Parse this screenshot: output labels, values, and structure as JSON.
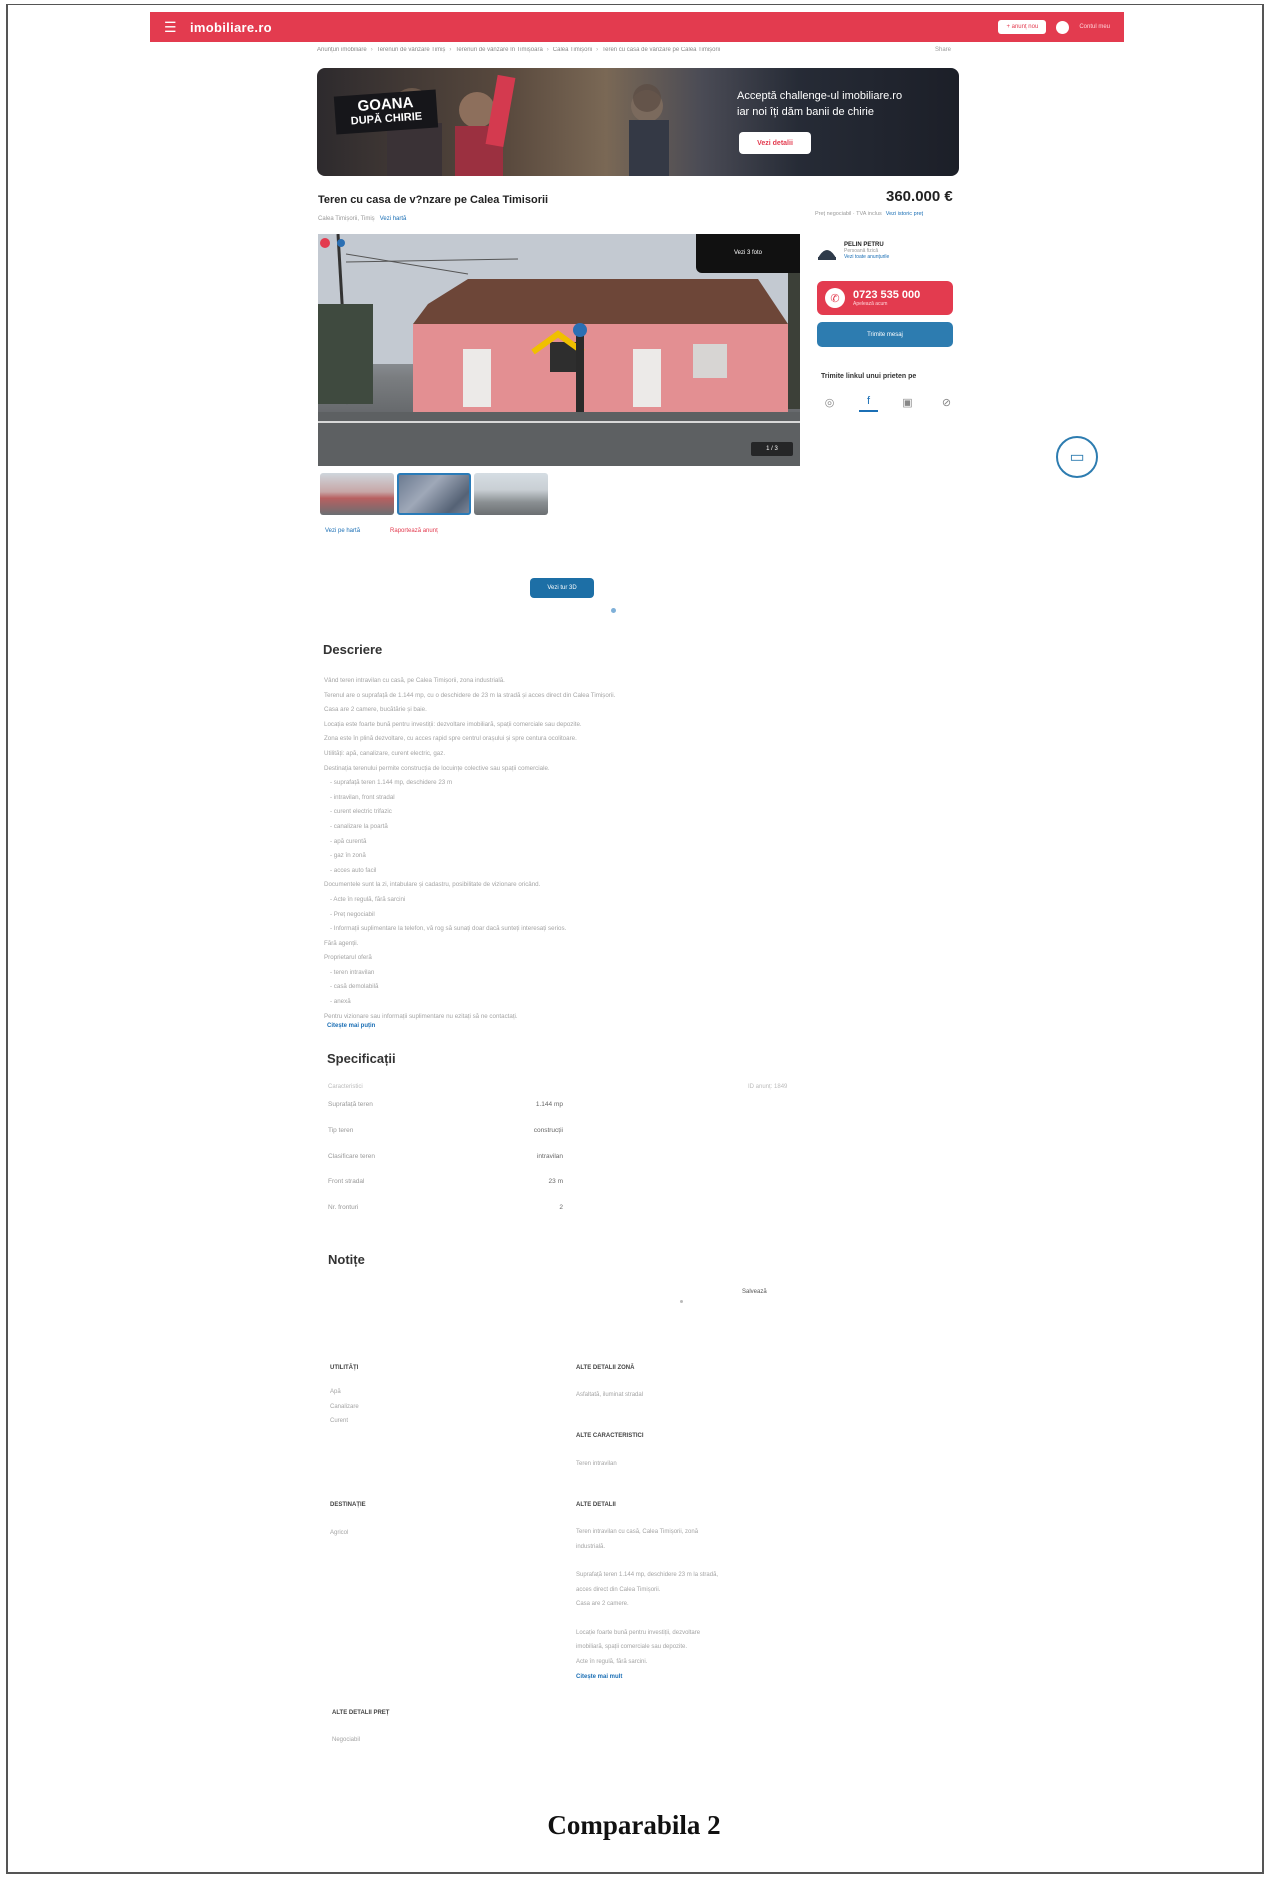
{
  "header": {
    "menu_icon": "hamburger-icon",
    "logo": "imobiliare.ro",
    "publish_label": "+ anunț nou",
    "account_label": "Contul meu"
  },
  "breadcrumb": [
    "Anunțuri imobiliare",
    "Terenuri de vânzare Timiș",
    "Terenuri de vânzare în Timișoara",
    "Calea Timișorii",
    "Teren cu casă de vânzare pe Calea Timișorii"
  ],
  "breadcrumb_share": "Share",
  "banner": {
    "title_line1": "GOANA",
    "title_line2": "DUPĂ CHIRIE",
    "text_line1": "Acceptă challenge-ul imobiliare.ro",
    "text_line2": "iar noi îți dăm banii de chirie",
    "button": "Vezi detalii"
  },
  "listing": {
    "title": "Teren cu casa de v?nzare pe Calea Timisorii",
    "location": "Calea Timișorii, Timiș",
    "map_link": "Vezi hartă",
    "price": "360.000 €",
    "price_info": "Preț negociabil · TVA inclus",
    "price_link": "Vezi istoric preț"
  },
  "photo": {
    "badge": "Vezi 3 foto",
    "counter": "1 / 3",
    "link_left": "Vezi pe hartă",
    "link_right": "Raportează anunț",
    "center_button": "Vezi tur 3D"
  },
  "agent": {
    "name": "PELIN PETRU",
    "role": "Persoană fizică",
    "link": "Vezi toate anunțurile",
    "phone": "0723 535 000",
    "phone_sub": "Apelează acum",
    "message_button": "Trimite mesaj",
    "share_title": "Trimite linkul unui prieten pe",
    "share_icons": [
      "whatsapp-icon",
      "facebook-icon",
      "messenger-icon",
      "link-icon"
    ]
  },
  "description": {
    "heading": "Descriere",
    "lines": [
      "Vând teren intravilan cu casă, pe Calea Timișorii, zona industrială.",
      "Terenul are o suprafață de 1.144 mp, cu o deschidere de 23 m la stradă și acces direct din Calea Timișorii.",
      "Casa are 2 camere, bucătărie și baie.",
      "Locația este foarte bună pentru investiții: dezvoltare imobiliară, spații comerciale sau depozite.",
      "Zona este în plină dezvoltare, cu acces rapid spre centrul orașului și spre centura ocolitoare.",
      "Utilități: apă, canalizare, curent electric, gaz.",
      "Destinația terenului permite construcția de locuințe colective sau spații comerciale.",
      "- suprafață teren 1.144 mp, deschidere 23 m",
      "- intravilan, front stradal",
      "- curent electric trifazic",
      "- canalizare la poartă",
      "- apă curentă",
      "- gaz în zonă",
      "- acces auto facil",
      "Documentele sunt la zi, intabulare și cadastru, posibilitate de vizionare oricând.",
      "- Acte în regulă, fără sarcini",
      "- Preț negociabil",
      "- Informații suplimentare la telefon, vă rog să sunați doar dacă sunteți interesați serios.",
      "Fără agenții.",
      "Proprietarul oferă",
      "- teren intravilan",
      "- casă demolabilă",
      "- anexă",
      "Pentru vizionare sau informații suplimentare nu ezitați să ne contactați."
    ],
    "more_link": "Citește mai puțin"
  },
  "specs": {
    "heading": "Specificații",
    "header_left": "Caracteristici",
    "header_right": "ID anunț: 1849",
    "rows": [
      {
        "key": "Suprafață teren",
        "value": "1.144 mp"
      },
      {
        "key": "Tip teren",
        "value": "construcții"
      },
      {
        "key": "Clasificare teren",
        "value": "intravilan"
      },
      {
        "key": "Front stradal",
        "value": "23 m"
      },
      {
        "key": "Nr. fronturi",
        "value": "2"
      }
    ]
  },
  "notes": {
    "heading": "Notițe",
    "save": "Salvează"
  },
  "details": {
    "utilities_h": "UTILITĂȚI",
    "utilities": [
      "Apă",
      "Canalizare",
      "Curent"
    ],
    "zone_h": "ALTE DETALII ZONĂ",
    "zone": "Asfaltată, iluminat stradal",
    "features_h": "ALTE CARACTERISTICI",
    "features": "Teren intravilan",
    "destination_h": "DESTINAȚIE",
    "destination": "Agricol",
    "other_h": "ALTE DETALII",
    "other": [
      "Teren intravilan cu casă, Calea Timișorii, zonă",
      "industrială.",
      "",
      "Suprafață teren 1.144 mp, deschidere 23 m la stradă,",
      "acces direct din Calea Timișorii.",
      "Casa are 2 camere.",
      "",
      "Locație foarte bună pentru investiții, dezvoltare",
      "imobiliară, spații comerciale sau depozite.",
      "Acte în regulă, fără sarcini."
    ],
    "other_more": "Citește mai mult",
    "price_h": "ALTE DETALII PREȚ",
    "price": "Negociabil"
  },
  "caption": "Comparabila 2"
}
